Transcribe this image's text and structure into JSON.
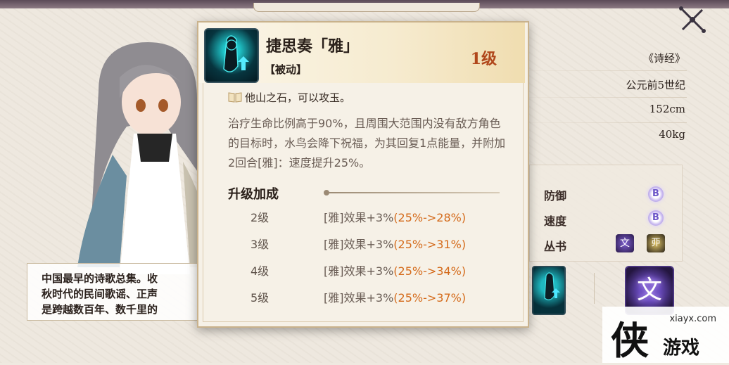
{
  "close_button": {
    "icon": "close-x-icon"
  },
  "profile": {
    "source": "《诗经》",
    "era": "公元前5世纪",
    "height": "152cm",
    "weight": "40kg",
    "stats": [
      {
        "label": "防御",
        "grade": "B"
      },
      {
        "label": "速度",
        "grade": "B"
      },
      {
        "label": "丛书",
        "grade": ""
      }
    ],
    "description_lines": [
      "中国最早的诗歌总集。收",
      "秋时代的民间歌谣、正声",
      "是跨越数百年、数千里的"
    ],
    "collection_icon_text": "文"
  },
  "skill": {
    "name": "捷思奏「雅」",
    "type": "【被动】",
    "level": "1级",
    "quote": "他山之石，可以攻玉。",
    "description": "治疗生命比例高于90%，且周围大范围内没有敌方角色的目标时，水鸟会降下祝福，为其回复1点能量，并附加2回合[雅]：速度提升25%。",
    "upgrade_title": "升级加成",
    "upgrades": [
      {
        "level": "2级",
        "effect": "[雅]效果+3%",
        "change": "(25%->28%)"
      },
      {
        "level": "3级",
        "effect": "[雅]效果+3%",
        "change": "(25%->31%)"
      },
      {
        "level": "4级",
        "effect": "[雅]效果+3%",
        "change": "(25%->34%)"
      },
      {
        "level": "5级",
        "effect": "[雅]效果+3%",
        "change": "(25%->37%)"
      }
    ]
  },
  "watermark": {
    "url": "xiayx.com",
    "char": "侠",
    "text": "游戏"
  }
}
